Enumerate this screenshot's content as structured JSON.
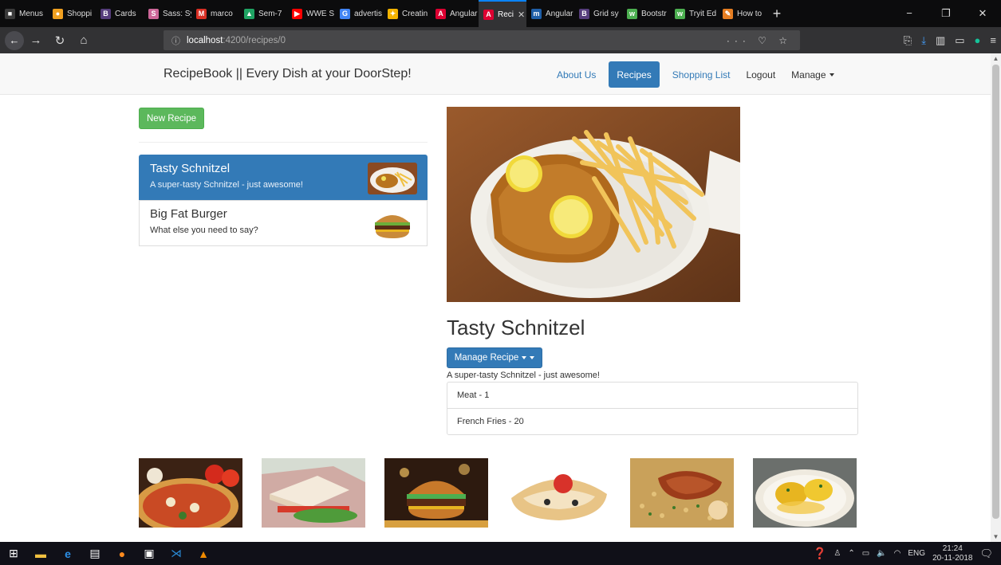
{
  "browser": {
    "tabs": [
      {
        "label": "Menus",
        "color": "#3a3a3a",
        "glyph": "■"
      },
      {
        "label": "Shoppi",
        "color": "#f0a020",
        "glyph": "●"
      },
      {
        "label": "Cards",
        "color": "#563d7c",
        "glyph": "B"
      },
      {
        "label": "Sass: Sy",
        "color": "#cd6799",
        "glyph": "S"
      },
      {
        "label": "marco",
        "color": "#d93025",
        "glyph": "M"
      },
      {
        "label": "Sem-7",
        "color": "#1fa463",
        "glyph": "▲"
      },
      {
        "label": "WWE S",
        "color": "#ff0000",
        "glyph": "▶"
      },
      {
        "label": "advertis",
        "color": "#4285f4",
        "glyph": "G"
      },
      {
        "label": "Creatin",
        "color": "#f4b400",
        "glyph": "✦"
      },
      {
        "label": "Angular",
        "color": "#dd0031",
        "glyph": "A"
      },
      {
        "label": "Reci",
        "color": "#dd0031",
        "glyph": "A",
        "active": true
      },
      {
        "label": "Angular",
        "color": "#1f5fa8",
        "glyph": "m"
      },
      {
        "label": "Grid sy",
        "color": "#563d7c",
        "glyph": "B"
      },
      {
        "label": "Bootstr",
        "color": "#4caf50",
        "glyph": "w"
      },
      {
        "label": "Tryit Ed",
        "color": "#4caf50",
        "glyph": "w"
      },
      {
        "label": "How to",
        "color": "#e67e22",
        "glyph": "✎"
      }
    ],
    "url_host": "localhost",
    "url_path": ":4200/recipes/0"
  },
  "site": {
    "brand": "RecipeBook || Every Dish at your DoorStep!",
    "nav": {
      "about": "About Us",
      "recipes": "Recipes",
      "shopping": "Shopping List",
      "logout": "Logout",
      "manage": "Manage"
    }
  },
  "list": {
    "new_button": "New Recipe",
    "recipes": [
      {
        "name": "Tasty Schnitzel",
        "description": "A super-tasty Schnitzel - just awesome!"
      },
      {
        "name": "Big Fat Burger",
        "description": "What else you need to say?"
      }
    ]
  },
  "detail": {
    "title": "Tasty Schnitzel",
    "manage_button": "Manage Recipe",
    "description": "A super-tasty Schnitzel - just awesome!",
    "ingredients": [
      "Meat - 1",
      "French Fries - 20"
    ]
  },
  "taskbar": {
    "time": "21:24",
    "date": "20-11-2018",
    "lang": "ENG"
  }
}
